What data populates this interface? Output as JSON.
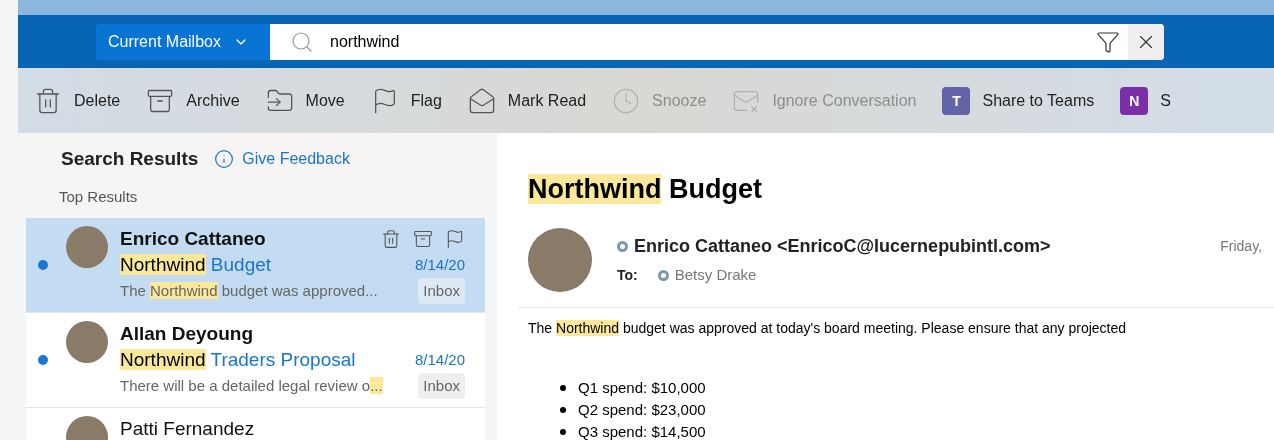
{
  "search": {
    "scope": "Current Mailbox",
    "query": "northwind"
  },
  "toolbar": [
    {
      "label": "Delete",
      "disabled": false
    },
    {
      "label": "Archive",
      "disabled": false
    },
    {
      "label": "Move",
      "disabled": false
    },
    {
      "label": "Flag",
      "disabled": false
    },
    {
      "label": "Mark Read",
      "disabled": false
    },
    {
      "label": "Snooze",
      "disabled": true
    },
    {
      "label": "Ignore Conversation",
      "disabled": true
    },
    {
      "label": "Share to Teams",
      "disabled": false,
      "logo_letter": "T"
    },
    {
      "label": "S",
      "disabled": false,
      "logo_letter": "N"
    }
  ],
  "message_list": {
    "title": "Search Results",
    "feedback_link": "Give Feedback",
    "section": "Top Results",
    "rows": [
      {
        "sender": "Enrico Cattaneo",
        "subject": [
          {
            "text": "Northwind",
            "highlight": true
          },
          {
            "text": " Budget",
            "highlight": false
          }
        ],
        "date": "8/14/20",
        "preview": [
          {
            "text": "The ",
            "highlight": false
          },
          {
            "text": "Northwind",
            "highlight": true
          },
          {
            "text": " budget was approved...",
            "highlight": false
          }
        ],
        "folder": "Inbox",
        "unread": true,
        "selected": true
      },
      {
        "sender": "Allan Deyoung",
        "subject": [
          {
            "text": "Northwind",
            "highlight": true
          },
          {
            "text": " Traders Proposal",
            "highlight": false
          }
        ],
        "date": "8/14/20",
        "preview": [
          {
            "text": "There will be a detailed legal review o",
            "highlight": false
          },
          {
            "text": "...",
            "highlight": true
          }
        ],
        "folder": "Inbox",
        "unread": true,
        "selected": false
      },
      {
        "sender": "Patti Fernandez",
        "selected": false,
        "unread": false
      }
    ]
  },
  "reading_pane": {
    "subject": [
      {
        "text": "Northwind",
        "highlight": true
      },
      {
        "text": " Budget",
        "highlight": false
      }
    ],
    "from": "Enrico Cattaneo <EnricoC@lucernepubintl.com>",
    "date": "Friday,",
    "to_label": "To:",
    "to": "Betsy Drake",
    "body": [
      {
        "text": "The ",
        "highlight": false
      },
      {
        "text": "Northwind",
        "highlight": true
      },
      {
        "text": " budget was approved at today's board meeting. Please ensure that any projected",
        "highlight": false
      }
    ],
    "bullets": [
      "Q1 spend: $10,000",
      "Q2 spend: $23,000",
      "Q3 spend: $14,500"
    ]
  }
}
